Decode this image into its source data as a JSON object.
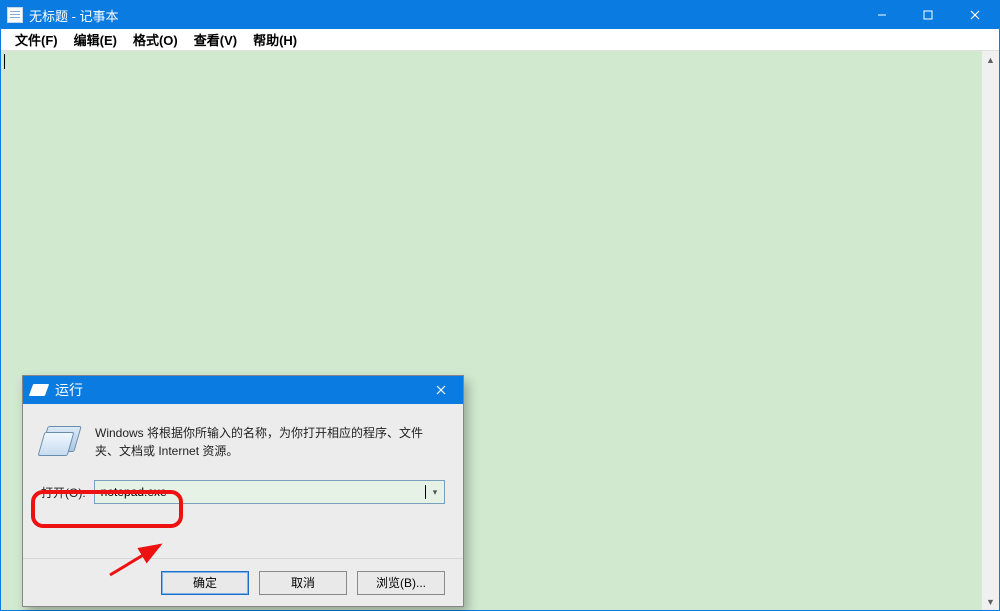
{
  "notepad": {
    "title": "无标题 - 记事本",
    "menu": {
      "file": "文件(F)",
      "edit": "编辑(E)",
      "format": "格式(O)",
      "view": "查看(V)",
      "help": "帮助(H)"
    }
  },
  "run_dialog": {
    "title": "运行",
    "description": "Windows 将根据你所输入的名称，为你打开相应的程序、文件夹、文档或 Internet 资源。",
    "open_label": "打开(O):",
    "input_value": "notepad.exe",
    "buttons": {
      "ok": "确定",
      "cancel": "取消",
      "browse": "浏览(B)..."
    }
  }
}
